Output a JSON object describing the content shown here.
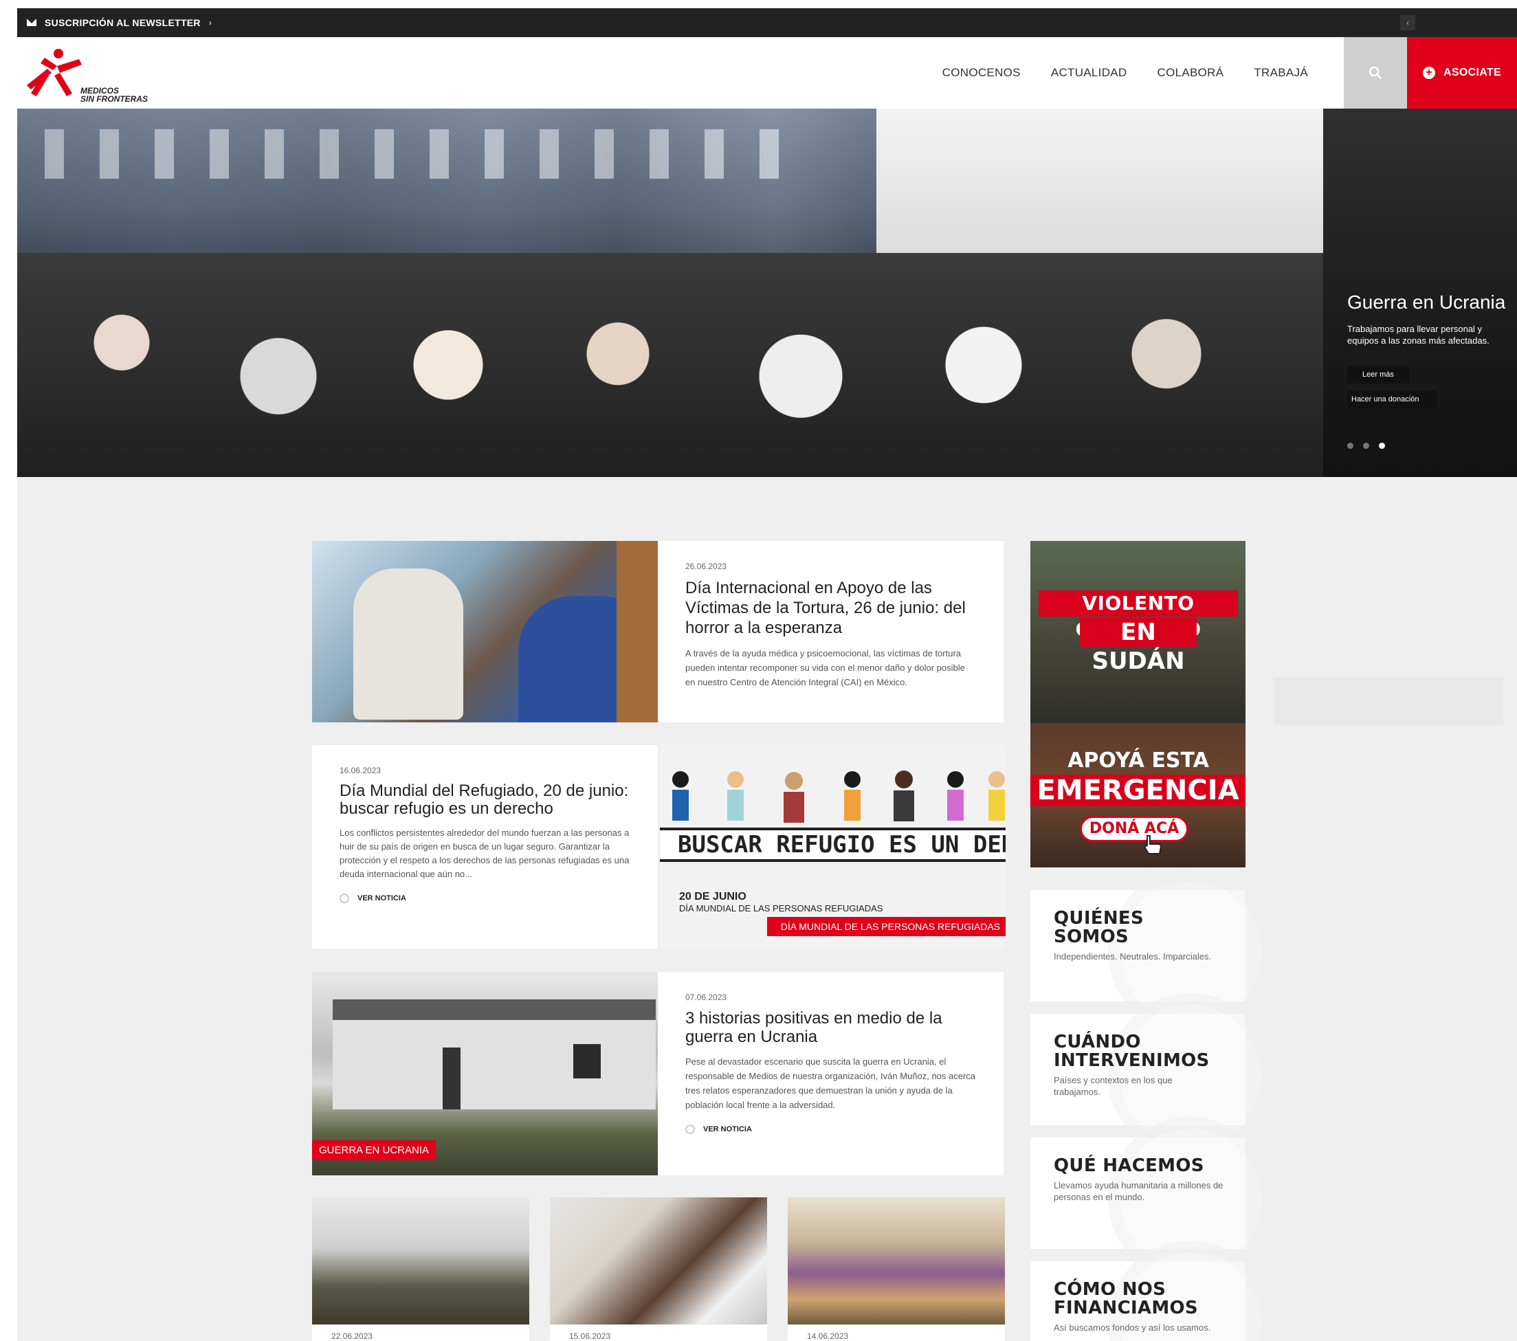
{
  "topbar": {
    "newsletter_label": "SUSCRIPCIÓN AL NEWSLETTER",
    "newsletter_arrow": "›",
    "back_glyph": "‹"
  },
  "header": {
    "logo_text_line1": "MEDICOS",
    "logo_text_line2": "SIN FRONTERAS",
    "nav": [
      "CONOCENOS",
      "ACTUALIDAD",
      "COLABORÁ",
      "TRABAJÁ"
    ],
    "join_label": "ASOCIATE",
    "join_icon": "plus-circle-icon",
    "search_icon": "search-icon",
    "brand_red": "#e1001a"
  },
  "hero": {
    "title": "Guerra en Ucrania",
    "text": "Trabajamos para llevar personal y equipos a las zonas más afectadas.",
    "read_more": "Leer más",
    "donate": "Hacer una donación",
    "dots": 3,
    "active_dot": 3
  },
  "news": [
    {
      "date": "26.06.2023",
      "title": "Día Internacional en Apoyo de las Víctimas de la Tortura, 26 de junio: del horror a la esperanza",
      "excerpt": "A través de la ayuda médica y psicoemocional, las víctimas de tortura pueden intentar recomponer su vida con el menor daño y dolor posible en nuestro Centro de Atención Integral (CAI) en México."
    },
    {
      "date": "16.06.2023",
      "title": "Día Mundial del Refugiado, 20 de junio: buscar refugio es un derecho",
      "excerpt": "Los conflictos persistentes alrededor del mundo fuerzan a las personas a huir de su país de origen en busca de un lugar seguro. Garantizar la protección y el respeto a los derechos de las personas refugiadas es una deuda internacional que aún no...",
      "cta": "VER NOTICIA",
      "image_text": "BUSCAR REFUGIO ES UN DERECHO",
      "image_sub1": "20 DE JUNIO",
      "image_sub2": "DÍA MUNDIAL DE LAS PERSONAS REFUGIADAS",
      "image_tag": "DÍA MUNDIAL DE LAS PERSONAS REFUGIADAS"
    },
    {
      "date": "07.06.2023",
      "title": "3 historias positivas en medio de la guerra en Ucrania",
      "excerpt": "Pese al devastador escenario que suscita la guerra en Ucrania, el responsable de Medios de nuestra organización, Iván Muñoz, nos acerca tres relatos esperanzadores que demuestran la unión y ayuda de la población local frente a la adversidad.",
      "cta": "VER NOTICIA",
      "tag": "GUERRA EN UCRANIA"
    }
  ],
  "banner": {
    "line1": "VIOLENTO CONFLICTO",
    "line2": "EN SUDÁN",
    "line3": "APOYÁ ESTA",
    "line4": "EMERGENCIA",
    "cta": "DONÁ ACÁ"
  },
  "info": [
    {
      "title": "QUIÉNES SOMOS",
      "text": "Independientes. Neutrales. Imparciales."
    },
    {
      "title": "CUÁNDO INTERVENIMOS",
      "text": "Países y contextos en los que trabajamos."
    },
    {
      "title": "QUÉ HACEMOS",
      "text": "Llevamos ayuda humanitaria a millones de personas en el mundo."
    },
    {
      "title": "CÓMO NOS FINANCIAMOS",
      "text": "Así buscamos fondos y así los usamos."
    }
  ],
  "mini": [
    {
      "date": "22.06.2023"
    },
    {
      "date": "15.06.2023"
    },
    {
      "date": "14.06.2023"
    }
  ]
}
